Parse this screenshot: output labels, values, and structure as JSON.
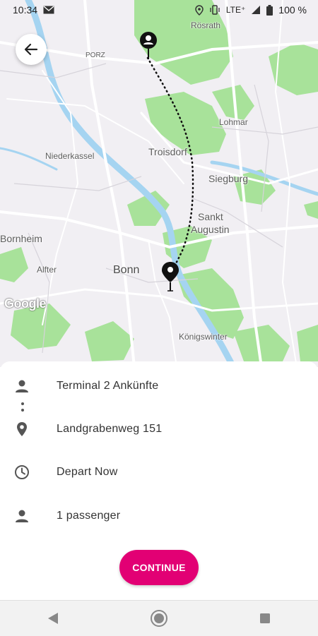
{
  "status_bar": {
    "time": "10:34",
    "network": "LTE⁺",
    "battery": "100 %",
    "icons": [
      "mail-icon",
      "location-icon",
      "vibrate-icon",
      "signal-icon",
      "battery-icon"
    ]
  },
  "map": {
    "labels": {
      "rosrath": "Rösrath",
      "porz": "PORZ",
      "lohmar": "Lohmar",
      "niederkassel": "Niederkassel",
      "troisdorf": "Troisdorf",
      "siegburg": "Siegburg",
      "sankt": "Sankt",
      "augustin": "Augustin",
      "bornheim": "Bornheim",
      "alfter": "Alfter",
      "bonn": "Bonn",
      "konigswinter": "Königswinter"
    },
    "attribution": "Google",
    "colors": {
      "background": "#f1eff3",
      "park": "#a8e29a",
      "water": "#a5d4f1",
      "road": "#ffffff"
    }
  },
  "trip": {
    "origin": "Terminal 2 Ankünfte",
    "destination": "Landgrabenweg 151",
    "time": "Depart Now",
    "passengers": "1 passenger"
  },
  "actions": {
    "continue": "CONTINUE"
  },
  "accent_color": "#e20074"
}
